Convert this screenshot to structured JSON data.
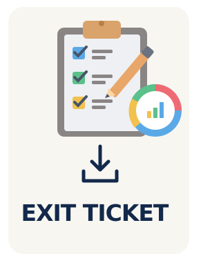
{
  "ticket": {
    "title": "EXIT TICKET"
  },
  "icons": {
    "illustration": "clipboard-checklist-with-pencil-and-chart-icon",
    "action": "download-icon"
  },
  "colors": {
    "background": "#f7f6f1",
    "title": "#13294b",
    "board": "#8a8585",
    "paper": "#eef0f4",
    "clip": "#d9a36b",
    "pencil": "#e8a769",
    "check_blue": "#5aa9e6",
    "check_green": "#5cc08a",
    "check_yellow": "#f2c14e",
    "chart_red": "#ef6b73",
    "chart_green": "#5cc08a"
  }
}
